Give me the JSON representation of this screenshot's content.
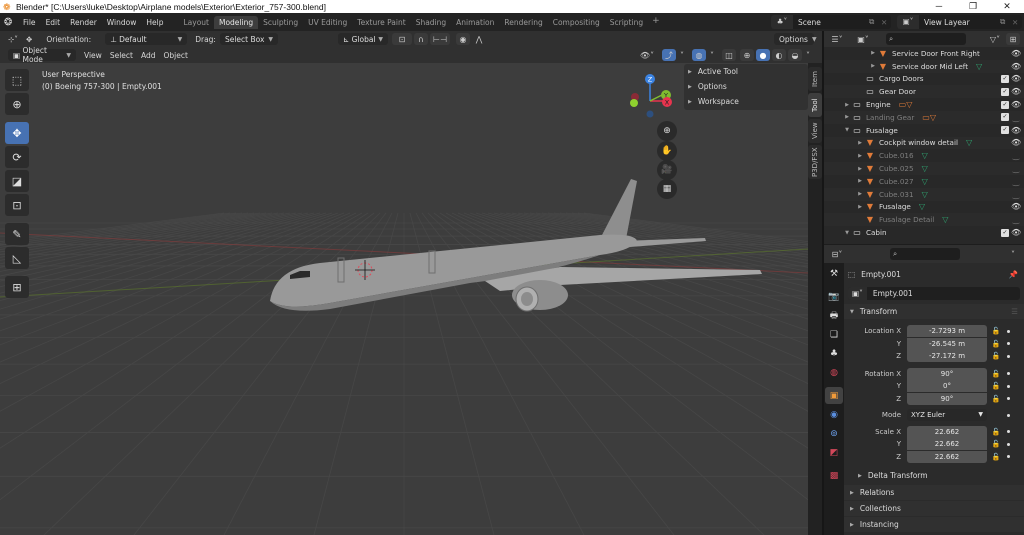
{
  "window": {
    "title": "Blender* [C:\\Users\\luke\\Desktop\\Airplane models\\Exterior\\Exterior_757-300.blend]",
    "controls": [
      "minimize",
      "restore",
      "close"
    ]
  },
  "menubar": {
    "menus": [
      "File",
      "Edit",
      "Render",
      "Window",
      "Help"
    ],
    "workspaces": [
      "Layout",
      "Modeling",
      "Sculpting",
      "UV Editing",
      "Texture Paint",
      "Shading",
      "Animation",
      "Rendering",
      "Compositing",
      "Scripting"
    ],
    "active_workspace": "Modeling",
    "add_workspace": "+",
    "scene": "Scene",
    "view_layer": "View Layear"
  },
  "tool_header": {
    "orientation_label": "Orientation:",
    "orientation_value": "Default",
    "drag_label": "Drag:",
    "drag_value": "Select Box",
    "transform_orientation": "Global",
    "options_label": "Options"
  },
  "viewport_header": {
    "mode": "Object Mode",
    "menus": [
      "View",
      "Select",
      "Add",
      "Object"
    ]
  },
  "viewport": {
    "view_name": "User Perspective",
    "object_info": "(0) Boeing 757-300 | Empty.001",
    "gizmo_axes": {
      "x": "X",
      "y": "Y",
      "z": "Z"
    },
    "colors": {
      "x_axis": "#e8344e",
      "y_axis": "#7fbc2f",
      "z_axis": "#3b83e2",
      "active_tool": "#4772b3"
    },
    "tools": [
      "select-box",
      "cursor",
      "move",
      "rotate",
      "scale",
      "transform",
      "annotate",
      "measure",
      "add-cube"
    ],
    "active_tool": "move",
    "nav_buttons": [
      "zoom",
      "pan",
      "camera",
      "ortho-toggle"
    ],
    "n_panel": {
      "sections": [
        "Active Tool",
        "Options",
        "Workspace"
      ]
    },
    "sidebar_tabs": [
      "Item",
      "Tool",
      "View",
      "P3D/FSX"
    ],
    "active_sidebar_tab": "Tool"
  },
  "outliner": {
    "search_placeholder": "",
    "rows": [
      {
        "name": "Service Door Front Right",
        "type": "mesh",
        "indent": 3,
        "disclosure": "collapsed",
        "dim": false,
        "eye": true,
        "checkbox": false,
        "modifier": ""
      },
      {
        "name": "Service door Mid Left",
        "type": "mesh",
        "indent": 3,
        "disclosure": "collapsed",
        "dim": false,
        "eye": true,
        "checkbox": false,
        "modifier": "data"
      },
      {
        "name": "Cargo Doors",
        "type": "collection",
        "indent": 2,
        "disclosure": "",
        "dim": false,
        "eye": true,
        "checkbox": true,
        "modifier": ""
      },
      {
        "name": "Gear Door",
        "type": "collection",
        "indent": 2,
        "disclosure": "",
        "dim": false,
        "eye": true,
        "checkbox": true,
        "modifier": ""
      },
      {
        "name": "Engine",
        "type": "collection",
        "indent": 1,
        "disclosure": "collapsed",
        "dim": false,
        "eye": true,
        "checkbox": true,
        "modifier": "collection-5 mesh-14"
      },
      {
        "name": "Landing Gear",
        "type": "collection",
        "indent": 1,
        "disclosure": "collapsed",
        "dim": true,
        "eye": false,
        "checkbox": true,
        "modifier": "collection-3 mesh-46"
      },
      {
        "name": "Fusalage",
        "type": "collection",
        "indent": 1,
        "disclosure": "expanded",
        "dim": false,
        "eye": true,
        "checkbox": true,
        "modifier": ""
      },
      {
        "name": "Cockpit window detail",
        "type": "mesh",
        "indent": 2,
        "disclosure": "collapsed",
        "dim": false,
        "eye": true,
        "checkbox": false,
        "modifier": "data"
      },
      {
        "name": "Cube.016",
        "type": "mesh",
        "indent": 2,
        "disclosure": "collapsed",
        "dim": true,
        "eye": false,
        "checkbox": false,
        "modifier": "data"
      },
      {
        "name": "Cube.025",
        "type": "mesh",
        "indent": 2,
        "disclosure": "collapsed",
        "dim": true,
        "eye": false,
        "checkbox": false,
        "modifier": "data"
      },
      {
        "name": "Cube.027",
        "type": "mesh",
        "indent": 2,
        "disclosure": "collapsed",
        "dim": true,
        "eye": false,
        "checkbox": false,
        "modifier": "data"
      },
      {
        "name": "Cube.031",
        "type": "mesh",
        "indent": 2,
        "disclosure": "collapsed",
        "dim": true,
        "eye": false,
        "checkbox": false,
        "modifier": "data"
      },
      {
        "name": "Fusalage",
        "type": "mesh",
        "indent": 2,
        "disclosure": "collapsed",
        "dim": false,
        "eye": true,
        "checkbox": false,
        "modifier": "data"
      },
      {
        "name": "Fusalage Detail",
        "type": "mesh",
        "indent": 2,
        "disclosure": "",
        "dim": true,
        "eye": false,
        "checkbox": false,
        "modifier": "data"
      },
      {
        "name": "Cabin",
        "type": "collection",
        "indent": 1,
        "disclosure": "expanded",
        "dim": false,
        "eye": true,
        "checkbox": true,
        "modifier": ""
      }
    ]
  },
  "properties": {
    "search_placeholder": "",
    "object_name": "Empty.001",
    "object_field": "Empty.001",
    "transform": {
      "title": "Transform",
      "location": {
        "label": "Location X",
        "x": "-2.7293 m",
        "y": "-26.545 m",
        "z": "-27.172 m"
      },
      "rotation": {
        "label": "Rotation X",
        "x": "90°",
        "y": "0°",
        "z": "90°"
      },
      "mode_label": "Mode",
      "mode_value": "XYZ Euler",
      "scale": {
        "label": "Scale X",
        "x": "22.662",
        "y": "22.662",
        "z": "22.662"
      },
      "axis_y": "Y",
      "axis_z": "Z"
    },
    "subpanels": [
      "Delta Transform"
    ],
    "panels": [
      "Relations",
      "Collections",
      "Instancing"
    ],
    "tabs": [
      "tool",
      "render",
      "output",
      "view-layer",
      "scene",
      "world",
      "object",
      "modifiers",
      "particles",
      "physics",
      "constraints",
      "data",
      "texture"
    ]
  }
}
